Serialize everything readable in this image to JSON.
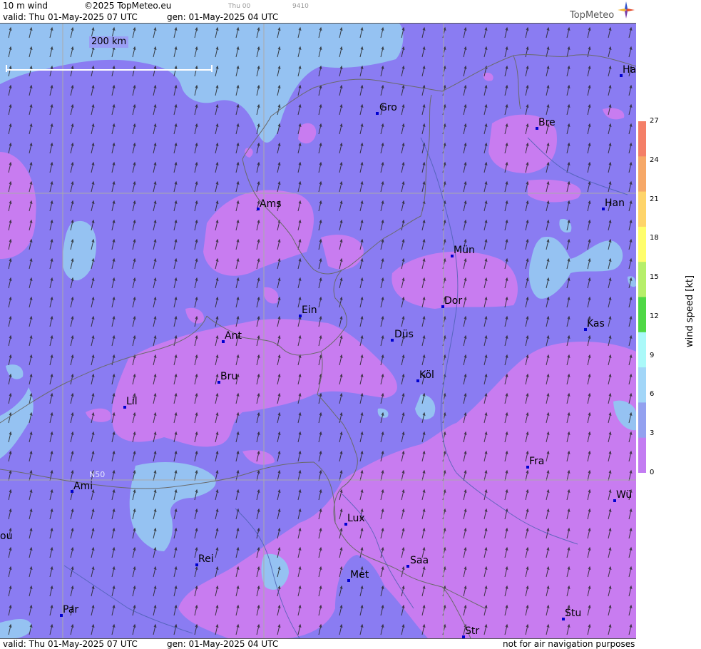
{
  "header": {
    "product": "10 m wind",
    "copyright": "©2025 TopMeteo.eu",
    "valid_line": "valid:  Thu  01-May-2025  07 UTC",
    "gen_line": "gen: 01-May-2025 04 UTC",
    "small_day": "Thu 00",
    "small_code": "9410",
    "logo": "TopMeteo"
  },
  "footer": {
    "valid_line": "valid:  Thu  01-May-2025  07 UTC",
    "gen_line": "gen: 01-May-2025 04 UTC",
    "disclaimer": "not for air navigation purposes"
  },
  "map": {
    "scale_label": "200 km",
    "latitude_label": "N50",
    "colors": {
      "calm": "#c87cf0",
      "light": "#8a7cf2",
      "moderate": "#95c2f2"
    },
    "cities": [
      {
        "name": "Gro"
      },
      {
        "name": "Bre"
      },
      {
        "name": "Ha"
      },
      {
        "name": "Ams"
      },
      {
        "name": "Han"
      },
      {
        "name": "Mün"
      },
      {
        "name": "Dor"
      },
      {
        "name": "Ein"
      },
      {
        "name": "Kas"
      },
      {
        "name": "Ant"
      },
      {
        "name": "Düs"
      },
      {
        "name": "Bru"
      },
      {
        "name": "Köl"
      },
      {
        "name": "Lil"
      },
      {
        "name": "Fra"
      },
      {
        "name": "Ami"
      },
      {
        "name": "Wü"
      },
      {
        "name": "Lux"
      },
      {
        "name": "ou"
      },
      {
        "name": "Rei"
      },
      {
        "name": "Saa"
      },
      {
        "name": "Met"
      },
      {
        "name": "Par"
      },
      {
        "name": "Stu"
      },
      {
        "name": "Str"
      }
    ]
  },
  "legend": {
    "title": "wind speed [kt]",
    "unit": "kt",
    "ticks": [
      "27",
      "24",
      "21",
      "18",
      "15",
      "12",
      "9",
      "6",
      "3",
      "0"
    ],
    "stops": [
      "#f47f68",
      "#f6a868",
      "#fed46a",
      "#fffe6c",
      "#b6ef6a",
      "#4fd846",
      "#aaf9f9",
      "#a2d6f8",
      "#93a1f0",
      "#c37cf2"
    ]
  }
}
